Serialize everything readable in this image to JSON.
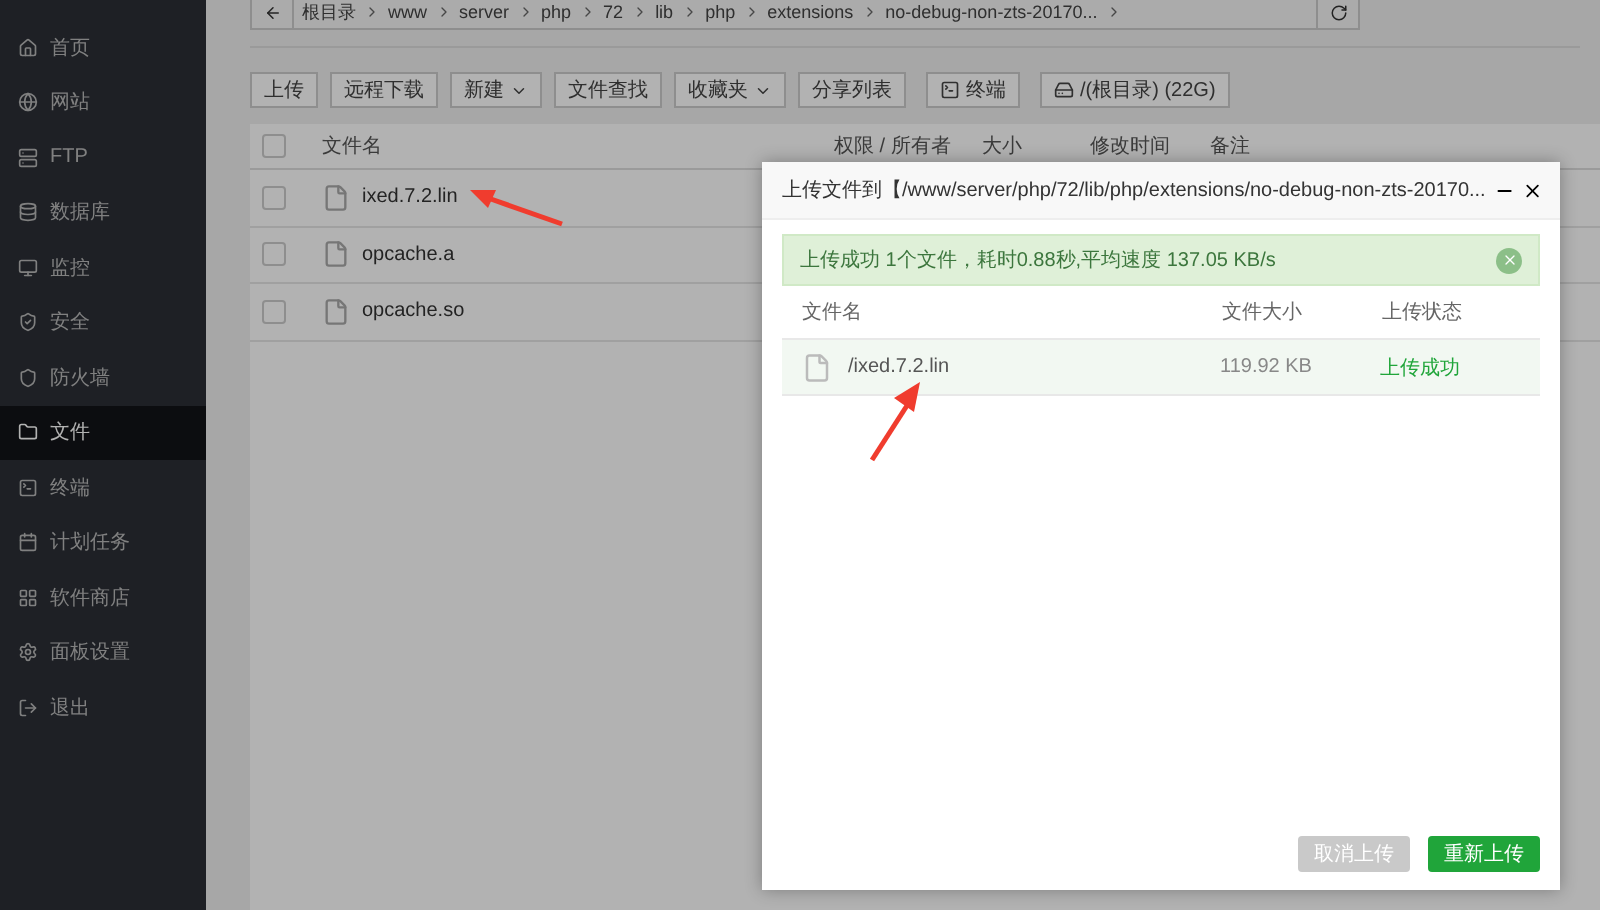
{
  "sidebar": {
    "items": [
      {
        "label": "首页",
        "selected": false
      },
      {
        "label": "网站",
        "selected": false
      },
      {
        "label": "FTP",
        "selected": false
      },
      {
        "label": "数据库",
        "selected": false
      },
      {
        "label": "监控",
        "selected": false
      },
      {
        "label": "安全",
        "selected": false
      },
      {
        "label": "防火墙",
        "selected": false
      },
      {
        "label": "文件",
        "selected": true
      },
      {
        "label": "终端",
        "selected": false
      },
      {
        "label": "计划任务",
        "selected": false
      },
      {
        "label": "软件商店",
        "selected": false
      },
      {
        "label": "面板设置",
        "selected": false
      },
      {
        "label": "退出",
        "selected": false
      }
    ]
  },
  "breadcrumb": {
    "segments": [
      "根目录",
      "www",
      "server",
      "php",
      "72",
      "lib",
      "php",
      "extensions",
      "no-debug-non-zts-20170..."
    ]
  },
  "toolbar": {
    "buttons": [
      {
        "label": "上传",
        "kind": "plain"
      },
      {
        "label": "远程下载",
        "kind": "plain"
      },
      {
        "label": "新建",
        "kind": "dropdown"
      },
      {
        "label": "文件查找",
        "kind": "plain"
      },
      {
        "label": "收藏夹",
        "kind": "dropdown"
      },
      {
        "label": "分享列表",
        "kind": "plain"
      },
      {
        "label": "终端",
        "kind": "terminal"
      },
      {
        "label": "/(根目录) (22G)",
        "kind": "disk"
      }
    ]
  },
  "file_table": {
    "all_checked": false,
    "columns": [
      "文件名",
      "权限 / 所有者",
      "大小",
      "修改时间",
      "备注"
    ],
    "rows": [
      {
        "name": "ixed.7.2.lin",
        "checked": false
      },
      {
        "name": "opcache.a",
        "checked": false
      },
      {
        "name": "opcache.so",
        "checked": false
      }
    ]
  },
  "upload_dialog": {
    "title": "上传文件到【/www/server/php/72/lib/php/extensions/no-debug-non-zts-20170...",
    "alert": "上传成功 1个文件，耗时0.88秒,平均速度 137.05 KB/s",
    "columns": [
      "文件名",
      "文件大小",
      "上传状态"
    ],
    "files": [
      {
        "name": "/ixed.7.2.lin",
        "size": "119.92 KB",
        "status": "上传成功"
      }
    ],
    "buttons": [
      {
        "label": "取消上传",
        "disabled": true
      },
      {
        "label": "重新上传",
        "disabled": false
      }
    ]
  }
}
